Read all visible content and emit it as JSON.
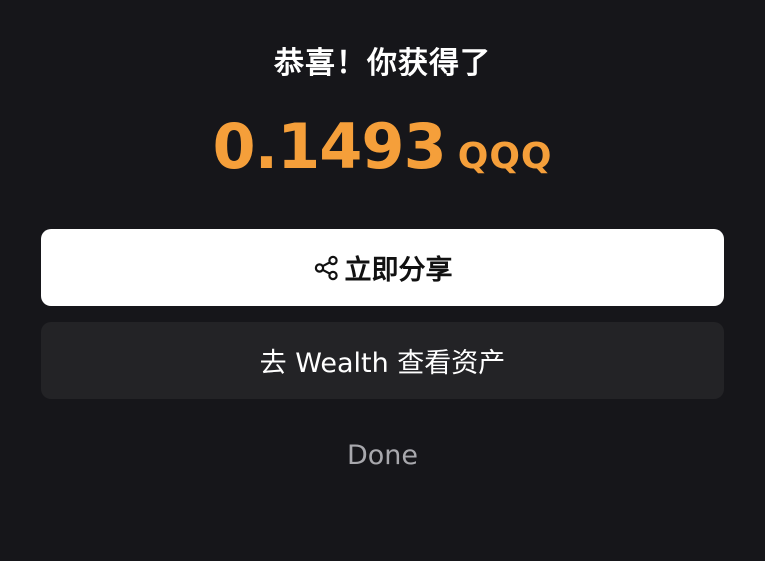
{
  "title": "恭喜！你获得了",
  "reward": {
    "amount": "0.1493",
    "unit": "QQQ",
    "color": "#f59f3a"
  },
  "buttons": {
    "share_label": "立即分享",
    "share_icon": "share-icon",
    "wealth_label": "去 Wealth 查看资产",
    "done_label": "Done"
  },
  "colors": {
    "background": "#16161a",
    "primary_button": "#ffffff",
    "secondary_button": "#232326",
    "done_text": "#a8a8ad"
  }
}
